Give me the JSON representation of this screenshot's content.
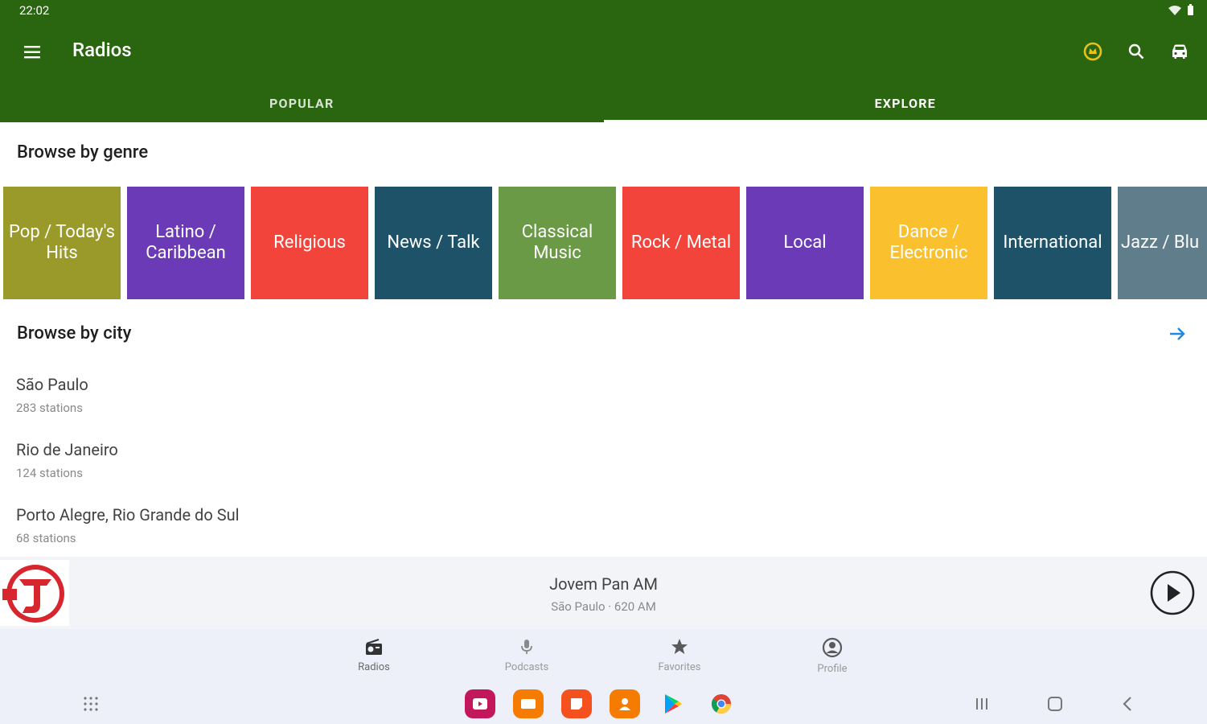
{
  "status": {
    "time": "22:02"
  },
  "appbar": {
    "title": "Radios"
  },
  "tabs": [
    {
      "label": "POPULAR"
    },
    {
      "label": "EXPLORE"
    }
  ],
  "genre_section": {
    "title": "Browse by genre"
  },
  "genres": [
    {
      "label": "Pop / Today's Hits",
      "color": "#9a9a2a"
    },
    {
      "label": "Latino / Caribbean",
      "color": "#6b3ab7"
    },
    {
      "label": "Religious",
      "color": "#f2443a"
    },
    {
      "label": "News / Talk",
      "color": "#1d5268"
    },
    {
      "label": "Classical Music",
      "color": "#6a9a45"
    },
    {
      "label": "Rock / Metal",
      "color": "#f2443a"
    },
    {
      "label": "Local",
      "color": "#6b3ab7"
    },
    {
      "label": "Dance / Electronic",
      "color": "#fbc02d"
    },
    {
      "label": "International",
      "color": "#1d5268"
    },
    {
      "label": "Jazz / Blu",
      "color": "#607d8b"
    }
  ],
  "city_section": {
    "title": "Browse by city"
  },
  "cities": [
    {
      "name": "São Paulo",
      "count": "283 stations"
    },
    {
      "name": "Rio de Janeiro",
      "count": "124 stations"
    },
    {
      "name": "Porto Alegre, Rio Grande do Sul",
      "count": "68 stations"
    }
  ],
  "player": {
    "title": "Jovem Pan AM",
    "subtitle": "São Paulo · 620 AM"
  },
  "nav": [
    {
      "label": "Radios",
      "icon": "radio-icon"
    },
    {
      "label": "Podcasts",
      "icon": "microphone-icon"
    },
    {
      "label": "Favorites",
      "icon": "star-icon"
    },
    {
      "label": "Profile",
      "icon": "profile-icon"
    }
  ],
  "colors": {
    "primary": "#2a6510",
    "accent": "#1e88e5",
    "nav_bg": "#eef0f9"
  }
}
